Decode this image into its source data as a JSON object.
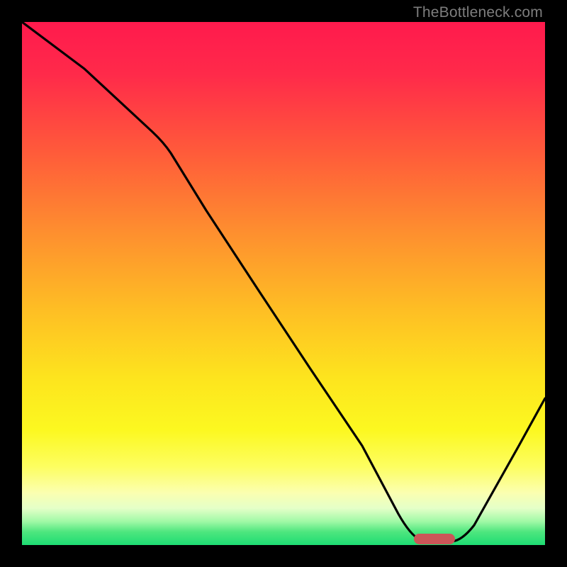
{
  "watermark": "TheBottleneck.com",
  "colors": {
    "frame_bg": "#000000",
    "marker": "#cb5658",
    "curve": "#000000",
    "gradient_stops": [
      "#ff1a4d",
      "#ff2a4a",
      "#ff5b3a",
      "#fe8e2f",
      "#febe24",
      "#fde41e",
      "#fcf820",
      "#fdfe60",
      "#fbffb0",
      "#e4ffc8",
      "#a0f9a6",
      "#4de67e",
      "#1edc73"
    ]
  },
  "chart_data": {
    "type": "line",
    "title": "",
    "xlabel": "",
    "ylabel": "",
    "xlim": [
      0,
      100
    ],
    "ylim": [
      0,
      100
    ],
    "series": [
      {
        "name": "curve",
        "x": [
          0,
          12,
          25,
          35,
          45,
          55,
          65,
          72,
          76,
          82,
          88,
          95,
          100
        ],
        "values": [
          100,
          91,
          79,
          64,
          49,
          34,
          19,
          6,
          0,
          0,
          7,
          19,
          28
        ]
      }
    ],
    "marker": {
      "x_start": 76,
      "x_end": 82,
      "y": 0,
      "shape": "rounded-bar"
    },
    "note": "x/y are normalized 0-100 across visible plot area; y read from top of gradient (100) to bottom (0); values estimated from pixel positions since no axes are shown"
  }
}
